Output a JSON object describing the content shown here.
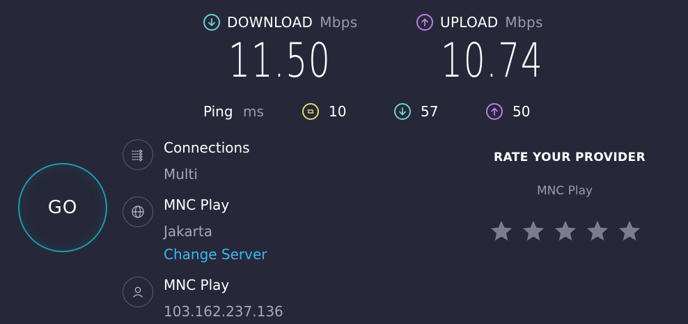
{
  "download": {
    "label": "DOWNLOAD",
    "unit": "Mbps",
    "value": "11.50"
  },
  "upload": {
    "label": "UPLOAD",
    "unit": "Mbps",
    "value": "10.74"
  },
  "ping": {
    "label": "Ping",
    "unit": "ms",
    "jitter": "10",
    "download_latency": "57",
    "upload_latency": "50"
  },
  "go_button": {
    "label": "GO"
  },
  "connections": {
    "title": "Connections",
    "value": "Multi"
  },
  "server": {
    "title": "MNC Play",
    "location": "Jakarta",
    "change_label": "Change Server"
  },
  "client": {
    "title": "MNC Play",
    "ip": "103.162.237.136"
  },
  "rating": {
    "title": "RATE YOUR PROVIDER",
    "provider": "MNC Play",
    "stars": 5
  },
  "icons": {
    "download": "arrow-down-circle-icon",
    "upload": "arrow-up-circle-icon",
    "jitter": "jitter-icon",
    "connections": "connections-icon",
    "server": "globe-icon",
    "client": "user-icon",
    "star": "star-icon"
  },
  "colors": {
    "background": "#262839",
    "download_accent": "#6ad3d4",
    "upload_accent": "#bb7ee8",
    "jitter_accent": "#e9d46b",
    "link": "#3fb6f2",
    "go_ring": "#1d9bb0"
  }
}
